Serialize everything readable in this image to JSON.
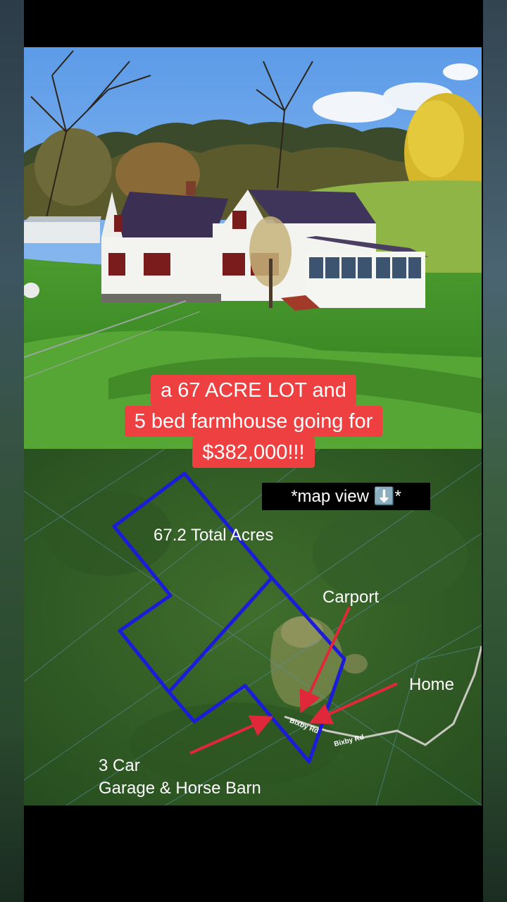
{
  "caption": {
    "line1": "a 67 ACRE LOT and",
    "line2": "5 bed farmhouse going for",
    "line3": "$382,000!!!"
  },
  "map": {
    "view_label": "*map view ⬇️*",
    "total_acres": "67.2 Total Acres",
    "carport": "Carport",
    "home": "Home",
    "garage_line1": "3 Car",
    "garage_line2": "Garage & Horse Barn",
    "road_1": "Bixby Rd",
    "road_2": "Bixby Rd"
  },
  "colors": {
    "caption_bg": "#ee4040",
    "boundary": "#1c1cd8",
    "arrow": "#e0283a"
  }
}
